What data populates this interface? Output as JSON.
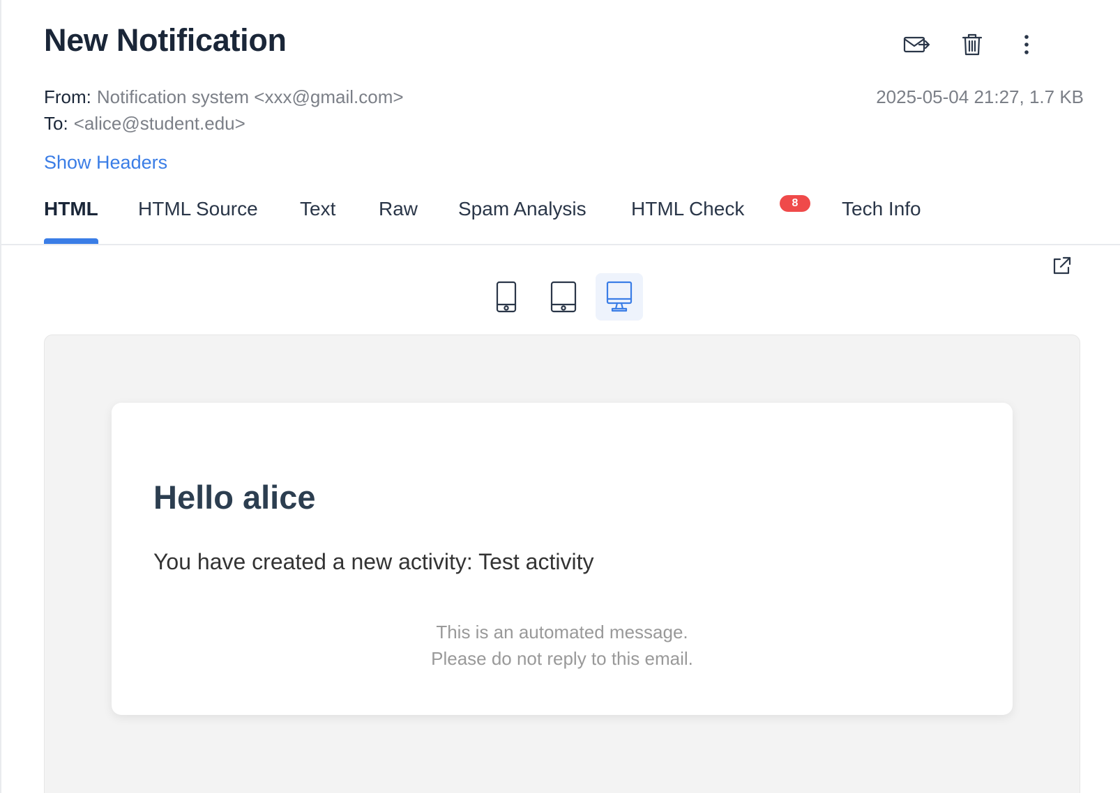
{
  "header": {
    "title": "New Notification"
  },
  "toolbar": {
    "forward_icon": "forward-mail-icon",
    "delete_icon": "trash-icon",
    "more_icon": "more-vertical-icon"
  },
  "meta": {
    "from_label": "From:",
    "from_value": "Notification system <xxx@gmail.com>",
    "to_label": "To:",
    "to_value": "<alice@student.edu>",
    "date_size": "2025-05-04 21:27, 1.7 KB"
  },
  "show_headers_label": "Show Headers",
  "tabs": [
    {
      "label": "HTML",
      "active": true
    },
    {
      "label": "HTML Source"
    },
    {
      "label": "Text"
    },
    {
      "label": "Raw"
    },
    {
      "label": "Spam Analysis"
    },
    {
      "label": "HTML Check",
      "badge": "8"
    },
    {
      "label": "Tech Info"
    }
  ],
  "devices": [
    {
      "name": "mobile",
      "icon": "mobile-icon"
    },
    {
      "name": "tablet",
      "icon": "tablet-icon"
    },
    {
      "name": "desktop",
      "icon": "desktop-icon",
      "selected": true
    }
  ],
  "email": {
    "greeting": "Hello alice",
    "body": "You have created a new activity: Test activity",
    "footer_line1": "This is an automated message.",
    "footer_line2": "Please do not reply to this email."
  },
  "colors": {
    "accent": "#3a7de6",
    "badge": "#ef4a4a",
    "preview_bg": "#f3f3f3"
  }
}
